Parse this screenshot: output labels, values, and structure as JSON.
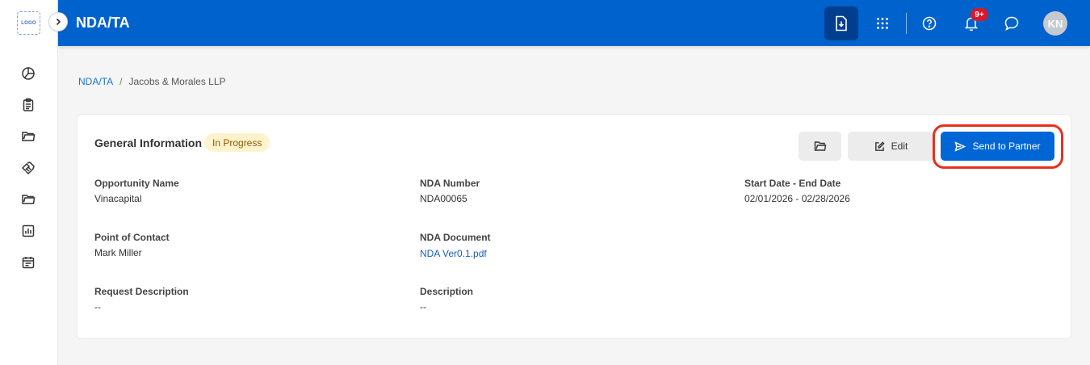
{
  "sidebar": {
    "logo_text": "LOGO",
    "items": [
      {
        "icon": "pie-chart-icon"
      },
      {
        "icon": "clipboard-icon"
      },
      {
        "icon": "folder-icon"
      },
      {
        "icon": "handshake-icon"
      },
      {
        "icon": "folder-open-icon"
      },
      {
        "icon": "report-chart-icon"
      },
      {
        "icon": "calendar-icon"
      }
    ]
  },
  "header": {
    "title": "NDA/TA",
    "notification_count": "9+",
    "avatar_initials": "KN"
  },
  "breadcrumb": {
    "root": "NDA/TA",
    "separator": "/",
    "current": "Jacobs & Morales LLP"
  },
  "card": {
    "title": "General Information",
    "status": "In Progress",
    "edit_label": "Edit",
    "send_label": "Send to Partner",
    "fields": {
      "opportunity_name": {
        "label": "Opportunity Name",
        "value": "Vinacapital"
      },
      "nda_number": {
        "label": "NDA Number",
        "value": "NDA00065"
      },
      "date_range": {
        "label": "Start Date - End Date",
        "value": "02/01/2026 - 02/28/2026"
      },
      "point_of_contact": {
        "label": "Point of Contact",
        "value": "Mark Miller"
      },
      "nda_document": {
        "label": "NDA Document",
        "value": "NDA Ver0.1.pdf"
      },
      "request_description": {
        "label": "Request Description",
        "value": "--"
      },
      "description": {
        "label": "Description",
        "value": "--"
      }
    }
  },
  "colors": {
    "header_bg": "#0062cc",
    "primary_button": "#0066d6",
    "status_bg": "#fff3cd",
    "highlight": "#e8301c"
  }
}
